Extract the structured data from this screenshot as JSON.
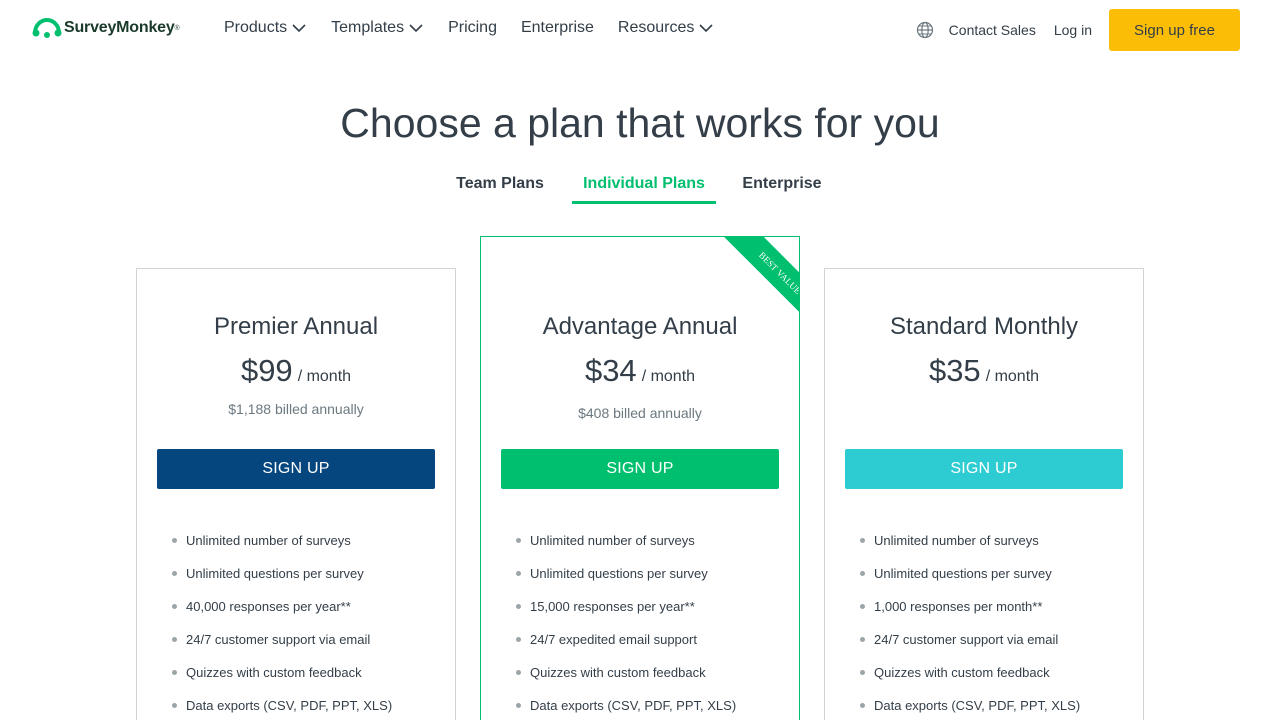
{
  "header": {
    "logo_text": "SurveyMonkey",
    "nav": [
      {
        "label": "Products",
        "has_dropdown": true
      },
      {
        "label": "Templates",
        "has_dropdown": true
      },
      {
        "label": "Pricing",
        "has_dropdown": false
      },
      {
        "label": "Enterprise",
        "has_dropdown": false
      },
      {
        "label": "Resources",
        "has_dropdown": true
      }
    ],
    "contact_sales": "Contact Sales",
    "login": "Log in",
    "signup": "Sign up free"
  },
  "page_title": "Choose a plan that works for you",
  "tabs": [
    {
      "label": "Team Plans",
      "active": false
    },
    {
      "label": "Individual Plans",
      "active": true
    },
    {
      "label": "Enterprise",
      "active": false
    }
  ],
  "plans": [
    {
      "name": "Premier Annual",
      "price": "$99",
      "period": "/ month",
      "billed": "$1,188 billed annually",
      "cta": "SIGN UP",
      "cta_color": "#05467e",
      "features": [
        "Unlimited number of surveys",
        "Unlimited questions per survey",
        "40,000 responses per year**",
        "24/7 customer support via email",
        "Quizzes with custom feedback",
        "Data exports (CSV, PDF, PPT, XLS)"
      ]
    },
    {
      "name": "Advantage Annual",
      "price": "$34",
      "period": "/ month",
      "billed": "$408 billed annually",
      "cta": "SIGN UP",
      "cta_color": "#00bf6f",
      "ribbon": "BEST VALUE",
      "features": [
        "Unlimited number of surveys",
        "Unlimited questions per survey",
        "15,000 responses per year**",
        "24/7 expedited email support",
        "Quizzes with custom feedback",
        "Data exports (CSV, PDF, PPT, XLS)"
      ]
    },
    {
      "name": "Standard Monthly",
      "price": "$35",
      "period": "/ month",
      "billed": "",
      "cta": "SIGN UP",
      "cta_color": "#2dccd3",
      "features": [
        "Unlimited number of surveys",
        "Unlimited questions per survey",
        "1,000 responses per month**",
        "24/7 customer support via email",
        "Quizzes with custom feedback",
        "Data exports (CSV, PDF, PPT, XLS)"
      ]
    }
  ],
  "colors": {
    "brand_green": "#00bf6f",
    "signup_yellow": "#fcbd07",
    "text": "#333e48"
  }
}
